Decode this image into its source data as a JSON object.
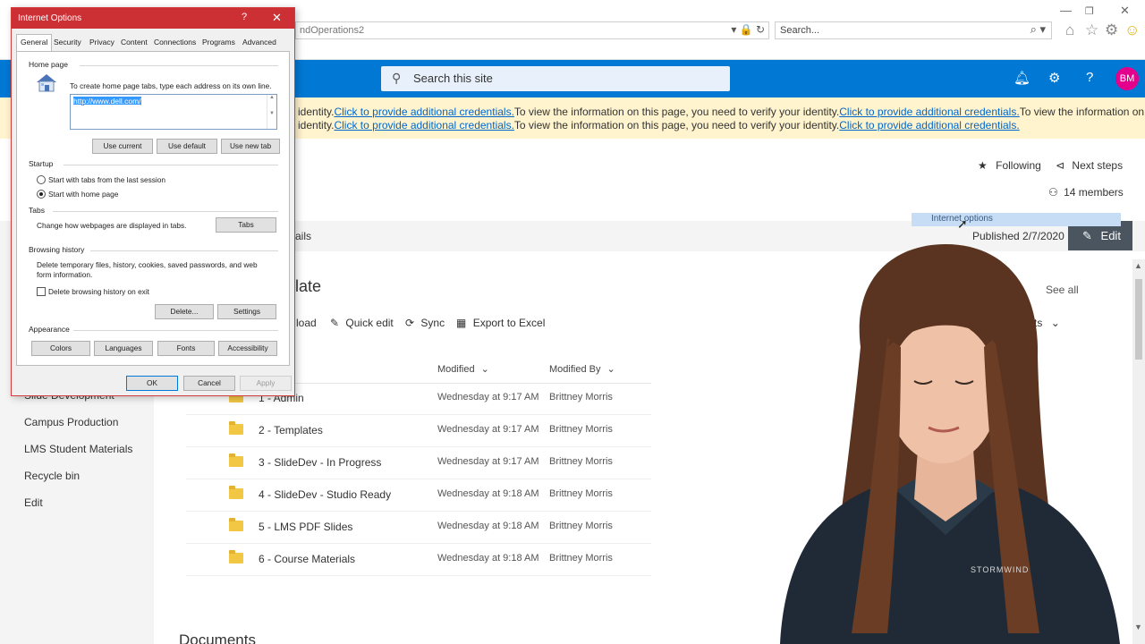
{
  "browser": {
    "address_tail": "ndOperations2",
    "search_placeholder": "Search...",
    "icons": [
      "home-icon",
      "favorites-star-icon",
      "settings-gear-icon",
      "feedback-smiley-icon"
    ]
  },
  "suitebar": {
    "search_placeholder": "Search this site",
    "avatar_initials": "BM"
  },
  "banner": {
    "line1": [
      {
        "text": "identity.",
        "link": false
      },
      {
        "text": "Click to provide additional credentials.",
        "link": true
      },
      {
        "text": "To view the information on this page, you need to verify your identity.",
        "link": false
      },
      {
        "text": "Click to provide additional credentials.",
        "link": true
      },
      {
        "text": "To view the information on",
        "link": false
      }
    ],
    "line2": [
      {
        "text": "identity.",
        "link": false
      },
      {
        "text": "Click to provide additional credentials.",
        "link": true
      },
      {
        "text": "To view the information on this page, you need to verify your identity.",
        "link": false
      },
      {
        "text": "Click to provide additional credentials.",
        "link": true
      }
    ]
  },
  "site_header": {
    "following": "Following",
    "next_steps": "Next steps",
    "members": "14 members",
    "published": "Published 2/7/2020",
    "edit": "Edit",
    "tooltip": "Internet options",
    "cmd_partial": "ails"
  },
  "leftnav": {
    "items": [
      "Slide Development",
      "Campus Production",
      "LMS Student Materials",
      "Recycle bin",
      "Edit"
    ]
  },
  "library": {
    "title_partial": "late",
    "see_all": "See all",
    "commands": {
      "upload": "load",
      "quick_edit": "Quick edit",
      "sync": "Sync",
      "export": "Export to Excel",
      "view_partial": "uments"
    },
    "columns": {
      "modified": "Modified",
      "modified_by": "Modified By"
    },
    "rows": [
      {
        "name": "1 - Admin",
        "modified": "Wednesday at 9:17 AM",
        "by": "Brittney Morris"
      },
      {
        "name": "2 - Templates",
        "modified": "Wednesday at 9:17 AM",
        "by": "Brittney Morris"
      },
      {
        "name": "3 - SlideDev - In Progress",
        "modified": "Wednesday at 9:17 AM",
        "by": "Brittney Morris"
      },
      {
        "name": "4 - SlideDev - Studio Ready",
        "modified": "Wednesday at 9:18 AM",
        "by": "Brittney Morris"
      },
      {
        "name": "5 - LMS PDF Slides",
        "modified": "Wednesday at 9:18 AM",
        "by": "Brittney Morris"
      },
      {
        "name": "6 - Course Materials",
        "modified": "Wednesday at 9:18 AM",
        "by": "Brittney Morris"
      }
    ],
    "documents_heading": "Documents"
  },
  "presenter": {
    "shirt_logo": "STORMWIND"
  },
  "dialog": {
    "title": "Internet Options",
    "help": "?",
    "close": "✕",
    "tabs": [
      "General",
      "Security",
      "Privacy",
      "Content",
      "Connections",
      "Programs",
      "Advanced"
    ],
    "home_page": {
      "heading": "Home page",
      "instruction": "To create home page tabs, type each address on its own line.",
      "url": "http://www.dell.com/",
      "use_current": "Use current",
      "use_default": "Use default",
      "use_new_tab": "Use new tab"
    },
    "startup": {
      "heading": "Startup",
      "option_last_session": "Start with tabs from the last session",
      "option_home_page": "Start with home page",
      "selected": "home_page"
    },
    "tabs_group": {
      "heading": "Tabs",
      "description": "Change how webpages are displayed in tabs.",
      "button": "Tabs"
    },
    "browsing_history": {
      "heading": "Browsing history",
      "description": "Delete temporary files, history, cookies, saved passwords, and web form information.",
      "delete_on_exit": "Delete browsing history on exit",
      "delete_on_exit_checked": false,
      "delete_button": "Delete...",
      "settings_button": "Settings"
    },
    "appearance": {
      "heading": "Appearance",
      "colors": "Colors",
      "languages": "Languages",
      "fonts": "Fonts",
      "accessibility": "Accessibility"
    },
    "footer": {
      "ok": "OK",
      "cancel": "Cancel",
      "apply": "Apply"
    }
  },
  "colors": {
    "suitebar": "#0078d4",
    "banner": "#fff4ce",
    "dialog_title": "#cc2f34",
    "avatar": "#e3008c",
    "edit_button": "#4a5560"
  }
}
